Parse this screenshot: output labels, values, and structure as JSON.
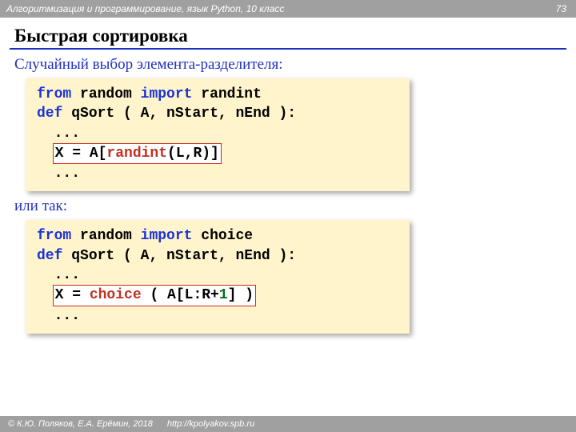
{
  "header": {
    "subject": "Алгоритмизация и программирование, язык Python, 10 класс",
    "page": "73"
  },
  "title": "Быстрая сортировка",
  "section1": "Случайный выбор элемента-разделителя:",
  "code1": {
    "from": "from",
    "module": "random",
    "import": "import",
    "name1": "randint",
    "def": "def",
    "fname": "qSort",
    "params": "( A, nStart, nEnd ):",
    "dots": "...",
    "xeq": "X = A[",
    "call": "randint",
    "args": "(L,R)]"
  },
  "section2": "или так:",
  "code2": {
    "from": "from",
    "module": "random",
    "import": "import",
    "name2": "choice",
    "def": "def",
    "fname": "qSort",
    "params": "( A, nStart, nEnd ):",
    "dots": "...",
    "xeq": "X = ",
    "call": "choice",
    "open": " ( A[L:R+",
    "one": "1",
    "close": "] )"
  },
  "footer": {
    "copyright": "© К.Ю. Поляков, Е.А. Ерёмин, 2018",
    "url": "http://kpolyakov.spb.ru"
  }
}
